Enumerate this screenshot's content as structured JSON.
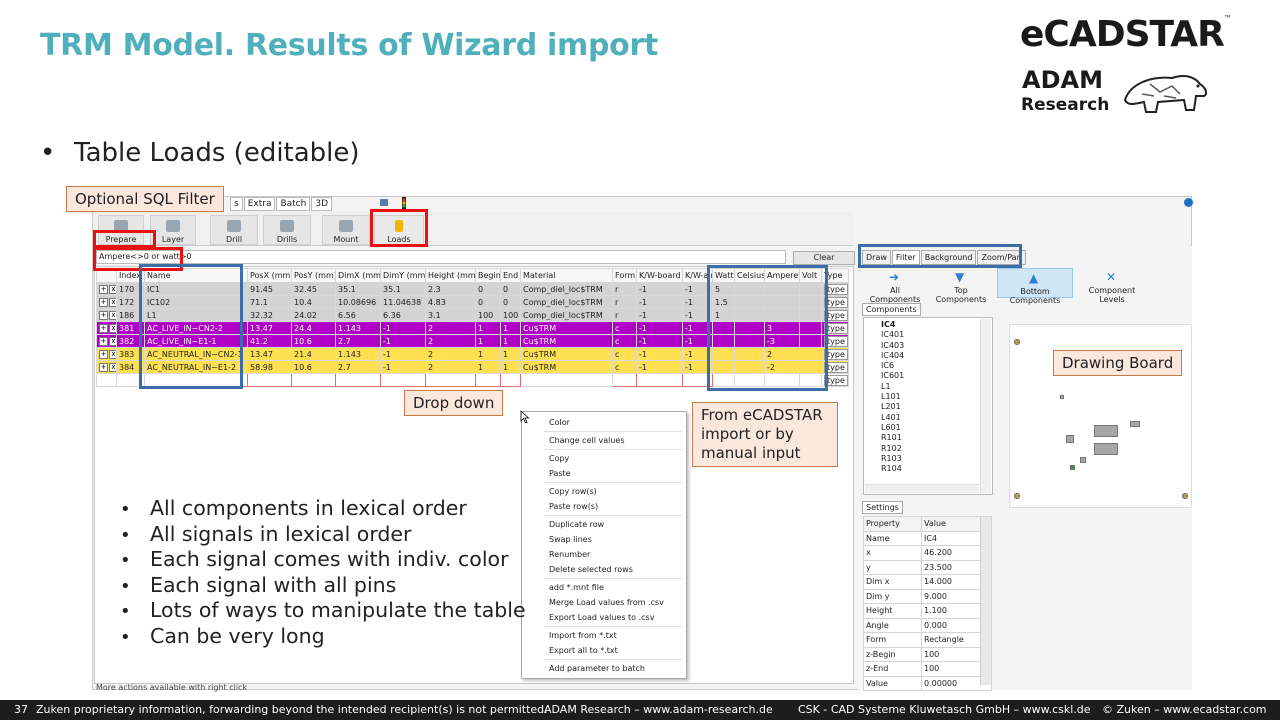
{
  "slide": {
    "title": "TRM Model. Results of Wizard import",
    "bullet_main": "Table Loads (editable)",
    "bullet_glyph": "•"
  },
  "logos": {
    "ecadstar": "eCADSTAR",
    "tm": "™",
    "adam": "ADAM",
    "research": "Research"
  },
  "app": {
    "menu_tabs": [
      "s",
      "Extra",
      "Batch",
      "3D"
    ],
    "ribbon_buttons": [
      "Prepare",
      "Layer",
      "Drill",
      "Drills",
      "Mount",
      "Loads"
    ],
    "filter_value": "Ampere<>0 or watt>0",
    "clear_label": "Clear",
    "columns": [
      "",
      "Index",
      "Name",
      "PosX (mm)",
      "PosY (mm)",
      "DimX (mm)",
      "DimY (mm)",
      "Height (mm)",
      "Begin",
      "End",
      "Material",
      "Form",
      "K/W-board",
      "K/W-air",
      "Watt",
      "Celsius",
      "Ampere",
      "Volt",
      "Type"
    ],
    "rows": [
      {
        "cls": "gray",
        "index": "170",
        "name": "IC1",
        "posx": "91.45",
        "posy": "32.45",
        "dimx": "35.1",
        "dimy": "35.1",
        "height": "2.3",
        "begin": "0",
        "end": "0",
        "material": "Comp_diel_loc$TRM",
        "form": "r",
        "kwb": "-1",
        "kwa": "-1",
        "watt": "5",
        "celsius": "",
        "ampere": "",
        "volt": "",
        "type": "type"
      },
      {
        "cls": "gray",
        "index": "172",
        "name": "IC102",
        "posx": "71.1",
        "posy": "10.4",
        "dimx": "10.08696",
        "dimy": "11.04638",
        "height": "4.83",
        "begin": "0",
        "end": "0",
        "material": "Comp_diel_loc$TRM",
        "form": "r",
        "kwb": "-1",
        "kwa": "-1",
        "watt": "1.5",
        "celsius": "",
        "ampere": "",
        "volt": "",
        "type": "type"
      },
      {
        "cls": "gray",
        "index": "186",
        "name": "L1",
        "posx": "32.32",
        "posy": "24.02",
        "dimx": "6.56",
        "dimy": "6.36",
        "height": "3.1",
        "begin": "100",
        "end": "100",
        "material": "Comp_diel_loc$TRM",
        "form": "r",
        "kwb": "-1",
        "kwa": "-1",
        "watt": "1",
        "celsius": "",
        "ampere": "",
        "volt": "",
        "type": "type"
      },
      {
        "cls": "purple",
        "index": "381",
        "name": "AC_LIVE_IN~CN2-2",
        "posx": "13.47",
        "posy": "24.4",
        "dimx": "1.143",
        "dimy": "-1",
        "height": "2",
        "begin": "1",
        "end": "1",
        "material": "Cu$TRM",
        "form": "c",
        "kwb": "-1",
        "kwa": "-1",
        "watt": "",
        "celsius": "",
        "ampere": "3",
        "volt": "",
        "type": "type"
      },
      {
        "cls": "purple",
        "index": "382",
        "name": "AC_LIVE_IN~E1-1",
        "posx": "41.2",
        "posy": "10.6",
        "dimx": "2.7",
        "dimy": "-1",
        "height": "2",
        "begin": "1",
        "end": "1",
        "material": "Cu$TRM",
        "form": "c",
        "kwb": "-1",
        "kwa": "-1",
        "watt": "",
        "celsius": "",
        "ampere": "-3",
        "volt": "",
        "type": "type"
      },
      {
        "cls": "yellow",
        "index": "383",
        "name": "AC_NEUTRAL_IN~CN2-1",
        "posx": "13.47",
        "posy": "21.4",
        "dimx": "1.143",
        "dimy": "-1",
        "height": "2",
        "begin": "1",
        "end": "1",
        "material": "Cu$TRM",
        "form": "c",
        "kwb": "-1",
        "kwa": "-1",
        "watt": "",
        "celsius": "",
        "ampere": "2",
        "volt": "",
        "type": "type"
      },
      {
        "cls": "yellow",
        "index": "384",
        "name": "AC_NEUTRAL_IN~E1-2",
        "posx": "58.98",
        "posy": "10.6",
        "dimx": "2.7",
        "dimy": "-1",
        "height": "2",
        "begin": "1",
        "end": "1",
        "material": "Cu$TRM",
        "form": "c",
        "kwb": "-1",
        "kwa": "-1",
        "watt": "",
        "celsius": "",
        "ampere": "-2",
        "volt": "",
        "type": "type"
      }
    ],
    "plus_label": "+",
    "x_label": "x",
    "context_menu": [
      "Color",
      "Change cell values",
      "Copy",
      "Paste",
      "Copy row(s)",
      "Paste row(s)",
      "Duplicate row",
      "Swap lines",
      "Renumber",
      "Delete selected rows",
      "add *.mnt file",
      "Merge Load values from .csv",
      "Export Load values to .csv",
      "Import from *.txt",
      "Export all to *.txt",
      "Add parameter to batch"
    ],
    "status_text": "More actions available with right click"
  },
  "right_panel": {
    "tabs": [
      "Draw",
      "Filter",
      "Background",
      "Zoom/Pan"
    ],
    "tools": [
      "All Components",
      "Top Components",
      "Bottom Components",
      "Component Levels"
    ],
    "components_label": "Components",
    "components": [
      "IC4",
      "IC401",
      "IC403",
      "IC404",
      "IC6",
      "IC601",
      "L1",
      "L101",
      "L201",
      "L401",
      "L601",
      "R101",
      "R102",
      "R103",
      "R104"
    ],
    "settings_label": "Settings",
    "settings_head": [
      "Property",
      "Value"
    ],
    "settings_rows": [
      [
        "Name",
        "IC4"
      ],
      [
        "x",
        "46.200"
      ],
      [
        "y",
        "23.500"
      ],
      [
        "Dim x",
        "14.000"
      ],
      [
        "Dim y",
        "9.000"
      ],
      [
        "Height",
        "1.100"
      ],
      [
        "Angle",
        "0.000"
      ],
      [
        "Form",
        "Rectangle"
      ],
      [
        "z-Begin",
        "100"
      ],
      [
        "z-End",
        "100"
      ],
      [
        "Value",
        "0.00000"
      ]
    ]
  },
  "callouts": {
    "sql_filter": "Optional SQL Filter",
    "drop_down": "Drop down",
    "from_line1": "From eCADSTAR",
    "from_line2": "import or by",
    "from_line3": "manual input",
    "drawing_board": "Drawing Board"
  },
  "bullets": [
    "All components in lexical order",
    "All signals in lexical order",
    "Each signal comes with indiv. color",
    "Each signal with all pins",
    "Lots of ways to manipulate the table",
    "Can be very long"
  ],
  "footer": {
    "page": "37",
    "notice": "Zuken proprietary information, forwarding beyond the intended recipient(s) is not permitted.",
    "adam": "ADAM Research – www.adam-research.de",
    "csk": "CSK - CAD Systeme Kluwetasch GmbH – www.cskl.de",
    "zuken": "© Zuken – www.ecadstar.com"
  },
  "colors": {
    "title": "#4fb0bb",
    "purple_row": "#b000c8",
    "yellow_row": "#ffe053",
    "highlight_red": "#e81010",
    "highlight_blue": "#3a6ea8",
    "callout_bg": "#fbe8dc"
  }
}
